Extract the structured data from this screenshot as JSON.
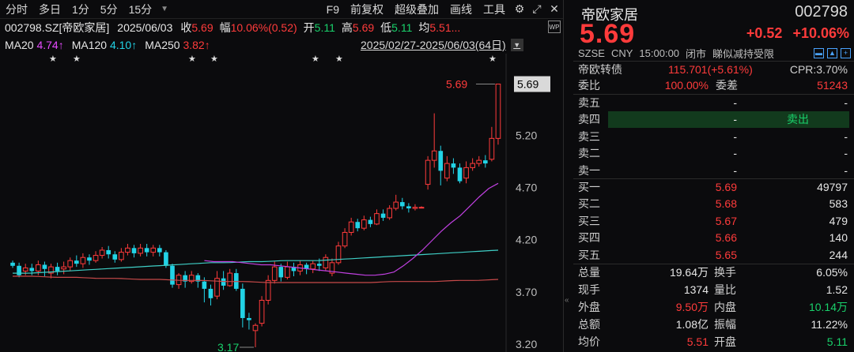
{
  "toolbar": {
    "items": [
      "分时",
      "多日",
      "1分",
      "5分",
      "15分"
    ],
    "right_items": [
      "F9",
      "前复权",
      "超级叠加",
      "画线",
      "工具"
    ]
  },
  "quote": {
    "code_name": "002798.SZ[帝欧家居]",
    "date": "2025/06/03",
    "close_label": "收",
    "close": "5.69",
    "amp_label": "幅",
    "amp": "10.06%(0.52)",
    "open_label": "开",
    "open": "5.11",
    "high_label": "高",
    "high": "5.69",
    "low_label": "低",
    "low": "5.11",
    "avg_label": "均",
    "avg": "5.51..."
  },
  "ma": {
    "ma20_label": "MA20",
    "ma20": "4.74↑",
    "ma120_label": "MA120",
    "ma120": "4.10↑",
    "ma250_label": "MA250",
    "ma250": "3.82↑"
  },
  "range": {
    "text": "2025/02/27-2025/06/03(64日)",
    "badge": "WP"
  },
  "chart_data": {
    "type": "candlestick",
    "y_ticks": [
      "5.69",
      "5.20",
      "4.70",
      "4.20",
      "3.70",
      "3.20"
    ],
    "ylim": [
      3.14,
      5.83
    ],
    "high_marker": "5.69",
    "low_marker": "3.17",
    "last_price_label": "5.69",
    "candles": [
      [
        3.98,
        3.95,
        4.0,
        3.93
      ],
      [
        3.95,
        3.86,
        3.98,
        3.84
      ],
      [
        3.9,
        3.93,
        3.97,
        3.86
      ],
      [
        3.93,
        3.9,
        3.97,
        3.86
      ],
      [
        3.9,
        3.96,
        4.0,
        3.86
      ],
      [
        3.96,
        3.92,
        3.99,
        3.85
      ],
      [
        3.88,
        3.94,
        3.97,
        3.83
      ],
      [
        3.94,
        3.9,
        3.98,
        3.86
      ],
      [
        3.92,
        3.94,
        3.99,
        3.87
      ],
      [
        3.94,
        4.0,
        4.03,
        3.9
      ],
      [
        4.0,
        3.97,
        4.05,
        3.94
      ],
      [
        3.97,
        4.03,
        4.07,
        3.93
      ],
      [
        4.03,
        4.0,
        4.06,
        3.96
      ],
      [
        4.0,
        4.05,
        4.09,
        3.98
      ],
      [
        4.05,
        4.1,
        4.13,
        4.02
      ],
      [
        4.1,
        4.06,
        4.14,
        4.02
      ],
      [
        4.06,
        4.01,
        4.09,
        3.98
      ],
      [
        4.01,
        4.08,
        4.12,
        3.99
      ],
      [
        4.08,
        4.12,
        4.16,
        4.05
      ],
      [
        4.12,
        4.07,
        4.15,
        4.03
      ],
      [
        4.07,
        4.12,
        4.16,
        4.04
      ],
      [
        4.12,
        4.08,
        4.16,
        4.04
      ],
      [
        4.08,
        4.12,
        4.15,
        4.04
      ],
      [
        4.12,
        4.08,
        4.15,
        4.04
      ],
      [
        4.08,
        3.95,
        4.1,
        3.93
      ],
      [
        3.95,
        3.77,
        3.97,
        3.74
      ],
      [
        3.77,
        3.86,
        3.88,
        3.73
      ],
      [
        3.86,
        3.8,
        3.9,
        3.74
      ],
      [
        3.8,
        3.86,
        3.9,
        3.78
      ],
      [
        3.86,
        3.8,
        3.88,
        3.74
      ],
      [
        3.8,
        3.73,
        3.84,
        3.6
      ],
      [
        3.73,
        3.64,
        3.77,
        3.57
      ],
      [
        3.66,
        3.83,
        3.9,
        3.63
      ],
      [
        3.83,
        3.76,
        3.9,
        3.72
      ],
      [
        3.76,
        3.88,
        3.92,
        3.75
      ],
      [
        3.88,
        3.73,
        3.92,
        3.71
      ],
      [
        3.73,
        3.45,
        3.78,
        3.36
      ],
      [
        3.45,
        3.43,
        3.5,
        3.34
      ],
      [
        3.33,
        3.38,
        3.4,
        3.17
      ],
      [
        3.4,
        3.62,
        3.66,
        3.37
      ],
      [
        3.62,
        3.81,
        3.86,
        3.58
      ],
      [
        3.81,
        3.94,
        3.99,
        3.78
      ],
      [
        3.94,
        3.84,
        3.97,
        3.8
      ],
      [
        3.84,
        3.94,
        3.99,
        3.82
      ],
      [
        3.94,
        3.9,
        3.98,
        3.85
      ],
      [
        3.9,
        3.96,
        4.0,
        3.86
      ],
      [
        3.96,
        3.92,
        3.98,
        3.87
      ],
      [
        3.92,
        3.97,
        4.0,
        3.88
      ],
      [
        3.97,
        3.95,
        4.02,
        3.9
      ],
      [
        3.93,
        4.03,
        4.06,
        3.9
      ],
      [
        3.88,
        3.98,
        4.02,
        3.85
      ],
      [
        3.98,
        4.14,
        4.18,
        3.96
      ],
      [
        4.14,
        4.27,
        4.31,
        4.12
      ],
      [
        4.27,
        4.37,
        4.41,
        4.24
      ],
      [
        4.37,
        4.31,
        4.4,
        4.28
      ],
      [
        4.31,
        4.39,
        4.43,
        4.29
      ],
      [
        4.39,
        4.35,
        4.42,
        4.32
      ],
      [
        4.35,
        4.45,
        4.49,
        4.34
      ],
      [
        4.45,
        4.41,
        4.49,
        4.38
      ],
      [
        4.41,
        4.5,
        4.53,
        4.39
      ],
      [
        4.5,
        4.56,
        4.63,
        4.48
      ],
      [
        4.56,
        4.52,
        4.6,
        4.49
      ],
      [
        4.52,
        4.5,
        4.55,
        4.46
      ],
      [
        4.5,
        4.51,
        4.54,
        4.48
      ],
      [
        4.51,
        4.51,
        4.52,
        4.5
      ],
      [
        4.73,
        4.96,
        5.0,
        4.68
      ],
      [
        4.96,
        5.05,
        5.41,
        4.89
      ],
      [
        5.05,
        4.86,
        5.1,
        4.72
      ],
      [
        4.79,
        4.93,
        5.0,
        4.76
      ],
      [
        4.93,
        4.89,
        4.98,
        4.83
      ],
      [
        4.89,
        4.76,
        4.93,
        4.74
      ],
      [
        4.79,
        4.89,
        4.95,
        4.74
      ],
      [
        4.89,
        4.93,
        4.98,
        4.86
      ],
      [
        4.93,
        4.96,
        5.0,
        4.9
      ],
      [
        4.96,
        4.93,
        5.01,
        4.89
      ],
      [
        4.97,
        5.17,
        5.28,
        4.95
      ],
      [
        5.17,
        5.69,
        5.69,
        5.11
      ]
    ],
    "ma20": [
      4.0,
      3.99,
      3.99,
      3.99,
      3.98,
      3.97,
      3.96,
      3.96,
      3.95,
      3.94,
      3.93,
      3.92,
      3.91,
      3.9,
      3.89,
      3.88,
      3.87,
      3.86,
      3.86,
      3.87,
      3.89,
      3.95,
      4.02,
      4.1,
      4.19,
      4.28,
      4.36,
      4.43,
      4.52,
      4.61,
      4.69,
      4.74
    ],
    "ma120": [
      3.88,
      3.88,
      3.89,
      3.9,
      3.91,
      3.92,
      3.93,
      3.94,
      3.95,
      3.96,
      3.97,
      3.98,
      3.98,
      3.99,
      3.99,
      4.0,
      4.0,
      4.0,
      4.01,
      4.02,
      4.03,
      4.04,
      4.05,
      4.06,
      4.07,
      4.08,
      4.09,
      4.1
    ],
    "ma250": [
      3.85,
      3.85,
      3.84,
      3.84,
      3.83,
      3.83,
      3.82,
      3.82,
      3.81,
      3.81,
      3.8,
      3.8,
      3.79,
      3.79,
      3.79,
      3.79,
      3.79,
      3.79,
      3.8,
      3.8,
      3.8,
      3.81,
      3.81,
      3.82
    ]
  },
  "panel": {
    "name": "帝欧家居",
    "code": "002798",
    "price": "5.69",
    "change": "+0.52",
    "change_pct": "+10.06%",
    "sub": {
      "exchange": "SZSE",
      "currency": "CNY",
      "time": "15:00:00",
      "status": "闭市",
      "note": "睇似减持受限"
    },
    "bond_label": "帝欧转债",
    "bond_value": "115.701(+5.61%)",
    "cpr": "CPR:3.70%",
    "weibi_label": "委比",
    "weibi": "100.00%",
    "weicha_label": "委差",
    "weicha": "51243",
    "sells": [
      {
        "label": "卖五",
        "price": "-",
        "vol": "-"
      },
      {
        "label": "卖四",
        "price": "-",
        "vol": "卖出"
      },
      {
        "label": "卖三",
        "price": "-",
        "vol": "-"
      },
      {
        "label": "卖二",
        "price": "-",
        "vol": "-"
      },
      {
        "label": "卖一",
        "price": "-",
        "vol": "-"
      }
    ],
    "buys": [
      {
        "label": "买一",
        "price": "5.69",
        "vol": "49797"
      },
      {
        "label": "买二",
        "price": "5.68",
        "vol": "583"
      },
      {
        "label": "买三",
        "price": "5.67",
        "vol": "479"
      },
      {
        "label": "买四",
        "price": "5.66",
        "vol": "140"
      },
      {
        "label": "买五",
        "price": "5.65",
        "vol": "244"
      }
    ],
    "stats": [
      {
        "l1": "总量",
        "v1": "19.64万",
        "l2": "换手",
        "v2": "6.05%"
      },
      {
        "l1": "现手",
        "v1": "1374",
        "l2": "量比",
        "v2": "1.52"
      },
      {
        "l1": "外盘",
        "v1": "9.50万",
        "l2": "内盘",
        "v2": "10.14万"
      },
      {
        "l1": "总额",
        "v1": "1.08亿",
        "l2": "振幅",
        "v2": "11.22%"
      },
      {
        "l1": "均价",
        "v1": "5.51",
        "l2": "开盘",
        "v2": "5.11"
      }
    ]
  }
}
